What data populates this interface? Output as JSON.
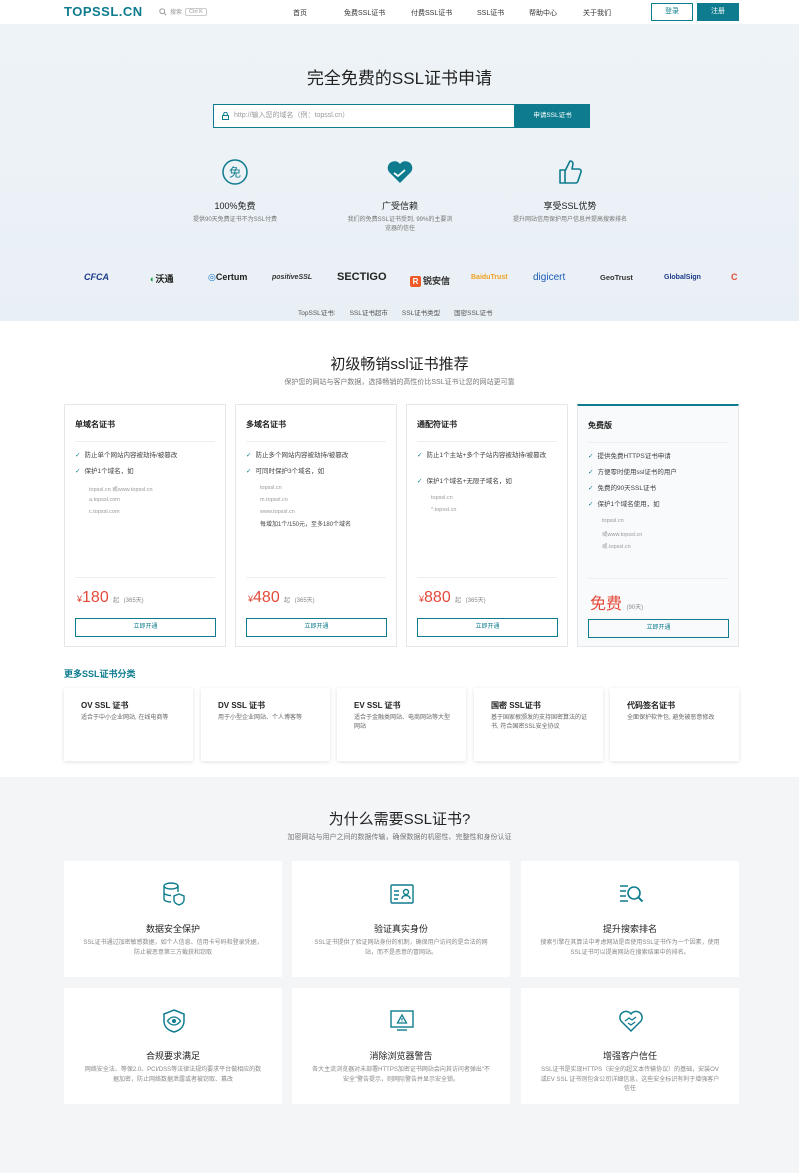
{
  "header": {
    "logo": "TOPSSL.CN",
    "search_label": "搜索",
    "search_kbd": "Ctrl K",
    "nav": [
      "首页",
      "免费SSL证书",
      "付费SSL证书",
      "SSL证书",
      "帮助中心",
      "关于我们"
    ],
    "login": "登录",
    "register": "注册"
  },
  "hero": {
    "title": "完全免费的SSL证书申请",
    "placeholder": "http://输入您的域名（例：topssl.cn）",
    "button": "申请SSL证书",
    "features": [
      {
        "title": "100%免费",
        "desc": "提供90天免费证书不为SSL付费",
        "icon": "free-icon"
      },
      {
        "title": "广受信赖",
        "desc": "我们的免费SSL证书受到, 99%的主要浏览器的信任",
        "icon": "handshake-heart-icon"
      },
      {
        "title": "享受SSL优势",
        "desc": "提升网站信用保护用户信息并提高搜索排名",
        "icon": "thumbs-up-icon"
      }
    ],
    "brands": [
      "CFCA",
      "沃通",
      "Certum",
      "positiveSSL",
      "SECTIGO",
      "锐安信",
      "BaiduTrust",
      "digicert",
      "GeoTrust",
      "GlobalSign",
      "C"
    ],
    "links": [
      "TopSSL证书:",
      "SSL证书超市",
      "SSL证书类型",
      "国密SSL证书"
    ]
  },
  "recommend": {
    "title": "初级畅销ssl证书推荐",
    "desc": "保护您的网站与客户数据，选择畅销的高性价比SSL证书让您的网站更可靠",
    "cards": [
      {
        "title": "单域名证书",
        "features": [
          "防止单个网站内容被劫持/被篡改",
          "保护1个域名，如"
        ],
        "examples": [
          "topssl.cn 或www.topssl.cn",
          "a.topssl.com",
          "c.topssl.com"
        ],
        "note": "",
        "price": "180",
        "unit": "¥",
        "suffix": "起",
        "period": "(365天)",
        "button": "立即开通"
      },
      {
        "title": "多域名证书",
        "features": [
          "防止多个网站内容被劫持/被篡改",
          "可同时保护3个域名，如"
        ],
        "examples": [
          "topssl.cn",
          "m.topssl.cn",
          "www.topssl.cn"
        ],
        "note": "每增加1个/150元，至多180个域名",
        "price": "480",
        "unit": "¥",
        "suffix": "起",
        "period": "(365天)",
        "button": "立即开通"
      },
      {
        "title": "通配符证书",
        "features": [
          "防止1个主站+多个子站内容被劫持/被篡改",
          "保护1个域名+无限子域名，如"
        ],
        "examples": [
          "topssl.cn",
          "*.topssl.cn"
        ],
        "note": "",
        "price": "880",
        "unit": "¥",
        "suffix": "起",
        "period": "(365天)",
        "button": "立即开通"
      },
      {
        "title": "免费版",
        "features": [
          "提供免费HTTPS证书申请",
          "方便零时使用ssl证书的用户",
          "免费的90天SSL证书",
          "保护1个域名使用，如"
        ],
        "examples": [
          "topssl.cn",
          "或www.topssl.cn",
          "或.topssl.cn"
        ],
        "note": "",
        "price": "免费",
        "unit": "",
        "suffix": "",
        "period": "(90天)",
        "button": "立即开通"
      }
    ]
  },
  "categories": {
    "title": "更多SSL证书分类",
    "items": [
      {
        "title": "OV SSL 证书",
        "desc": "适合于中小企业网站, 在线电商等"
      },
      {
        "title": "DV SSL 证书",
        "desc": "用于小型企业网站、个人博客等"
      },
      {
        "title": "EV SSL 证书",
        "desc": "适合于金融类网站、电商网站等大型网站"
      },
      {
        "title": "国密 SSL证书",
        "desc": "基于国家根颁发的支持国密算法的证书, 符合国密SSL安全协议"
      },
      {
        "title": "代码签名证书",
        "desc": "全面保护软件包, 避免被恶意修改"
      }
    ]
  },
  "why": {
    "title": "为什么需要SSL证书?",
    "desc": "加密网站与用户之间的数据传输，确保数据的机密性、完整性和身份认证",
    "items": [
      {
        "title": "数据安全保护",
        "desc": "SSL证书通过加密敏感数据，如个人信息、信用卡号码和登录凭据，防止被恶意第三方截获和窃取",
        "icon": "database-shield-icon"
      },
      {
        "title": "验证真实身份",
        "desc": "SSL证书提供了验证网站身份的机制，确保用户访问的是合法的网站，而不是恶意的冒网站。",
        "icon": "id-card-icon"
      },
      {
        "title": "提升搜索排名",
        "desc": "搜索引擎在其算法中考虑网站是否使用SSL证书作为一个因素，使用SSL证书可以提高网站在搜索结果中的排名。",
        "icon": "search-list-icon"
      },
      {
        "title": "合规要求满足",
        "desc": "网络安全法、等保2.0、PCI/DSS等法律法规均要求平台做相应的数据加密，防止网络数据泄露或者被窃取、篡改",
        "icon": "shield-eye-icon"
      },
      {
        "title": "消除浏览器警告",
        "desc": "各大主流浏览器对未部署HTTPS加密证书网站会向其访问者弹出“不安全”警告提示，则网际警告并显示安全锁。",
        "icon": "warning-screen-icon"
      },
      {
        "title": "增强客户信任",
        "desc": "SSL证书是实现HTTPS（安全的超文本传输协议）的基础，安装OV或EV SSL 证书则包含公司详细信息，这些安全标识有利于增强客户信任",
        "icon": "handshake-icon"
      }
    ]
  },
  "colors": {
    "accent": "#0e7c8e",
    "price": "#e34a3a"
  }
}
